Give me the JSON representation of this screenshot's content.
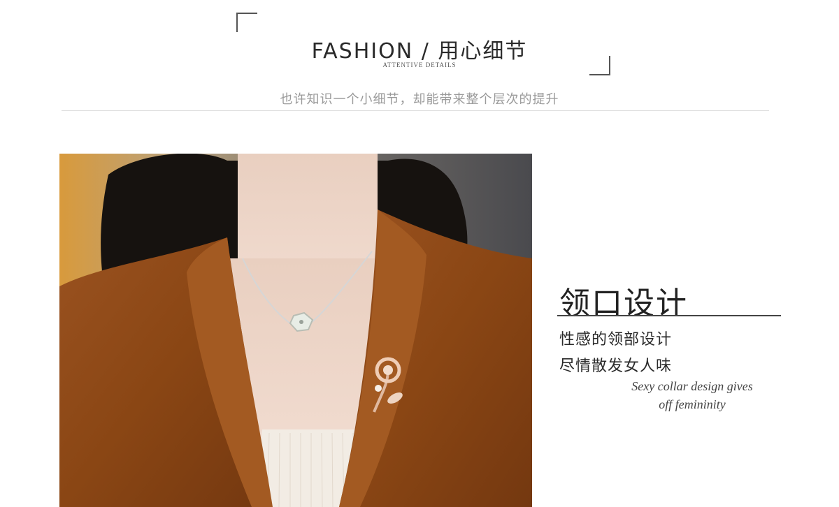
{
  "header": {
    "title": "FASHION / 用心细节",
    "subtitle": "ATTENTIVE DETAILS",
    "tagline": "也许知识一个小细节，却能带来整个层次的提升"
  },
  "feature": {
    "title": "领口设计",
    "line1": "性感的领部设计",
    "line2": "尽情散发女人味",
    "english_line1": "Sexy collar design gives",
    "english_line2": "off femininity"
  },
  "colors": {
    "cardigan": "#8a4a1a",
    "accent_rule": "#444444",
    "tagline_gray": "#9a9a9a"
  }
}
